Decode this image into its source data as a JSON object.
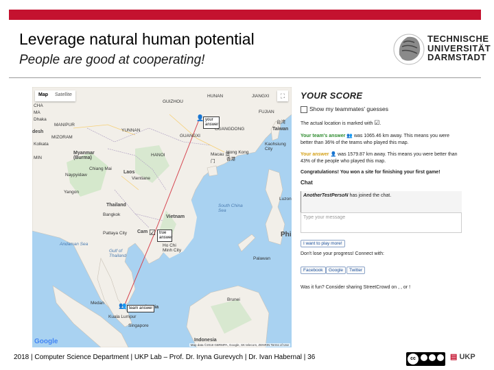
{
  "slide": {
    "title": "Leverage natural human potential",
    "subtitle": "People are good at cooperating!"
  },
  "logo": {
    "line1": "TECHNISCHE",
    "line2": "UNIVERSITÄT",
    "line3": "DARMSTADT"
  },
  "map": {
    "map_type": [
      "Map",
      "Satellite"
    ],
    "fullscreen_icon": "fullscreen-icon",
    "labels": {
      "guizhou": "GUIZHOU",
      "hunan": "HUNAN",
      "jiangxi": "JIANGXI",
      "fujian": "FUJIAN",
      "taiwan": "Taiwan",
      "taiwan_cn": "台湾",
      "guangxi": "GUANGXI",
      "guangdong": "GUANGDONG",
      "yunnan": "YUNNAN",
      "kaohsiung": "Kaohsiung City",
      "macau": "Macau 澳门",
      "hongkong": "Hong Kong 香港",
      "hanoi": "HANOI",
      "myanmar": "Myanmar (Burma)",
      "chiang_mai": "Chiang Mai",
      "laos": "Laos",
      "vientiane": "Vientiane",
      "naypyidaw": "Naypyidaw",
      "yangon": "Yangon",
      "thailand": "Thailand",
      "bangkok": "Bangkok",
      "vietnam": "Vietnam",
      "luzon": "Luzon",
      "south_china_sea": "South China Sea",
      "pattaya": "Pattaya City",
      "gulf_thailand": "Gulf of Thailand",
      "cambodia": "Cam",
      "hcmc": "Ho Chi Minh City",
      "andaman": "Andaman Sea",
      "phil": "Phil",
      "palawan": "Palawan",
      "medan": "Medan",
      "malaysia": "Malaysia",
      "kuala_lumpur": "Kuala Lumpur",
      "singapore": "Singapore",
      "brunei": "Brunei",
      "indonesia": "Indonesia",
      "desh": "desh",
      "manipur": "MANIPUR",
      "mizoram": "MIZORAM",
      "dhaka": "Dhaka",
      "kolkata": "Kolkata",
      "ma": "MA",
      "cha": "CHA",
      "min": "MIN"
    },
    "pins": {
      "your_answer": "your answer",
      "true_answer": "true answer",
      "team_answer": "team answer"
    },
    "google": "Google",
    "attribution": "Map data ©2018 GBRMPA, Google, SK telecom, ZENRIN   Terms of Use"
  },
  "score_panel": {
    "title": "YOUR SCORE",
    "show_teammates": "Show my teammates' guesses",
    "actual_location_pre": "The actual location is marked with",
    "actual_location_post": ".",
    "team_label": "Your team's answer",
    "team_text": "was 1065.46 km away. This means you were better than 36% of the teams who played this map.",
    "your_label": "Your answer",
    "your_text": "was 1579.87 km away. This means you were better than 43% of the people who played this map.",
    "congrats": "Congratulations! You won a site for finishing your first game!",
    "chat_heading": "Chat",
    "chat_user": "AnotherTestPersoN",
    "chat_event": "has joined the chat.",
    "message_placeholder": "Type your message",
    "play_more": "I want to play more!",
    "progress_text": "Don't lose your progress! Connect with:",
    "social": [
      "Facebook",
      "Google",
      "Twitter"
    ],
    "fun_text": "Was it fun? Consider sharing StreetCrowd on , , or !"
  },
  "footer": {
    "text": "2018  |  Computer Science Department  |  UKP Lab – Prof. Dr. Iryna Gurevych  |  Dr. Ivan Habernal  |  36",
    "ukp": "UKP",
    "cc": "cc"
  },
  "colors": {
    "accent_red": "#c4122f",
    "sea": "#a9d2f1",
    "land": "#f2efe9",
    "guess_line": "#d64550"
  }
}
